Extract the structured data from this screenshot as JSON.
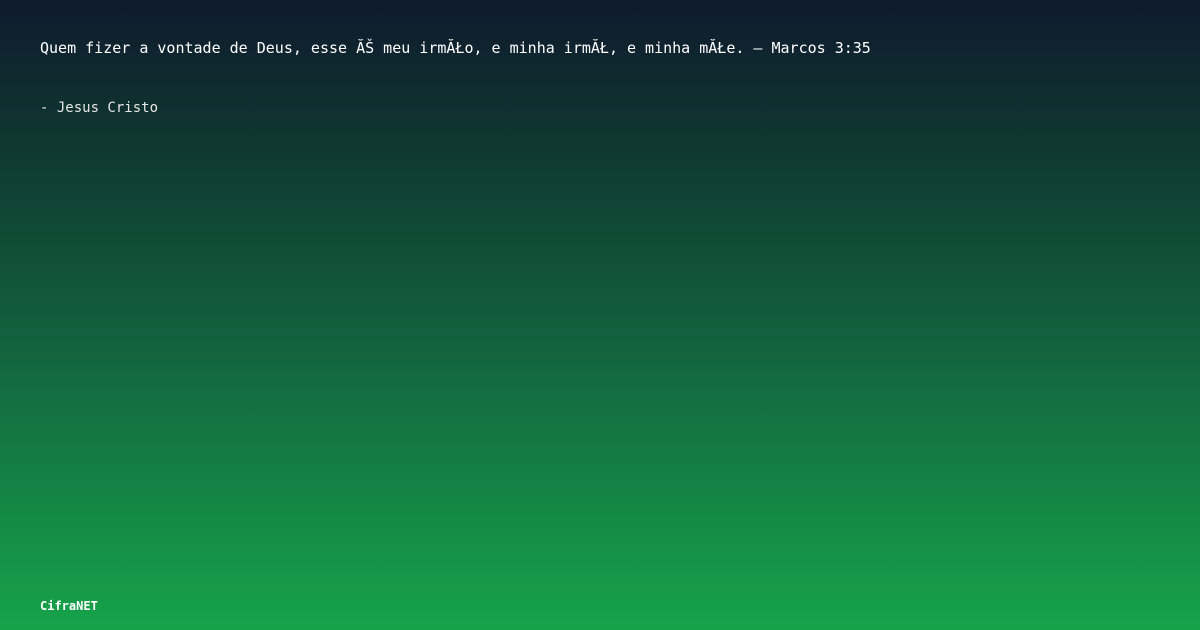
{
  "quote": {
    "text": "Quem fizer a vontade de Deus, esse ĂŠ meu irmĂŁo, e minha irmĂŁ, e minha mĂŁe. – Marcos 3:35"
  },
  "author": {
    "text": "- Jesus Cristo"
  },
  "brand": {
    "name": "CifraNET"
  },
  "colors": {
    "gradient_top": "#0f1a2e",
    "gradient_bottom": "#16a34a",
    "text": "#ffffff"
  }
}
